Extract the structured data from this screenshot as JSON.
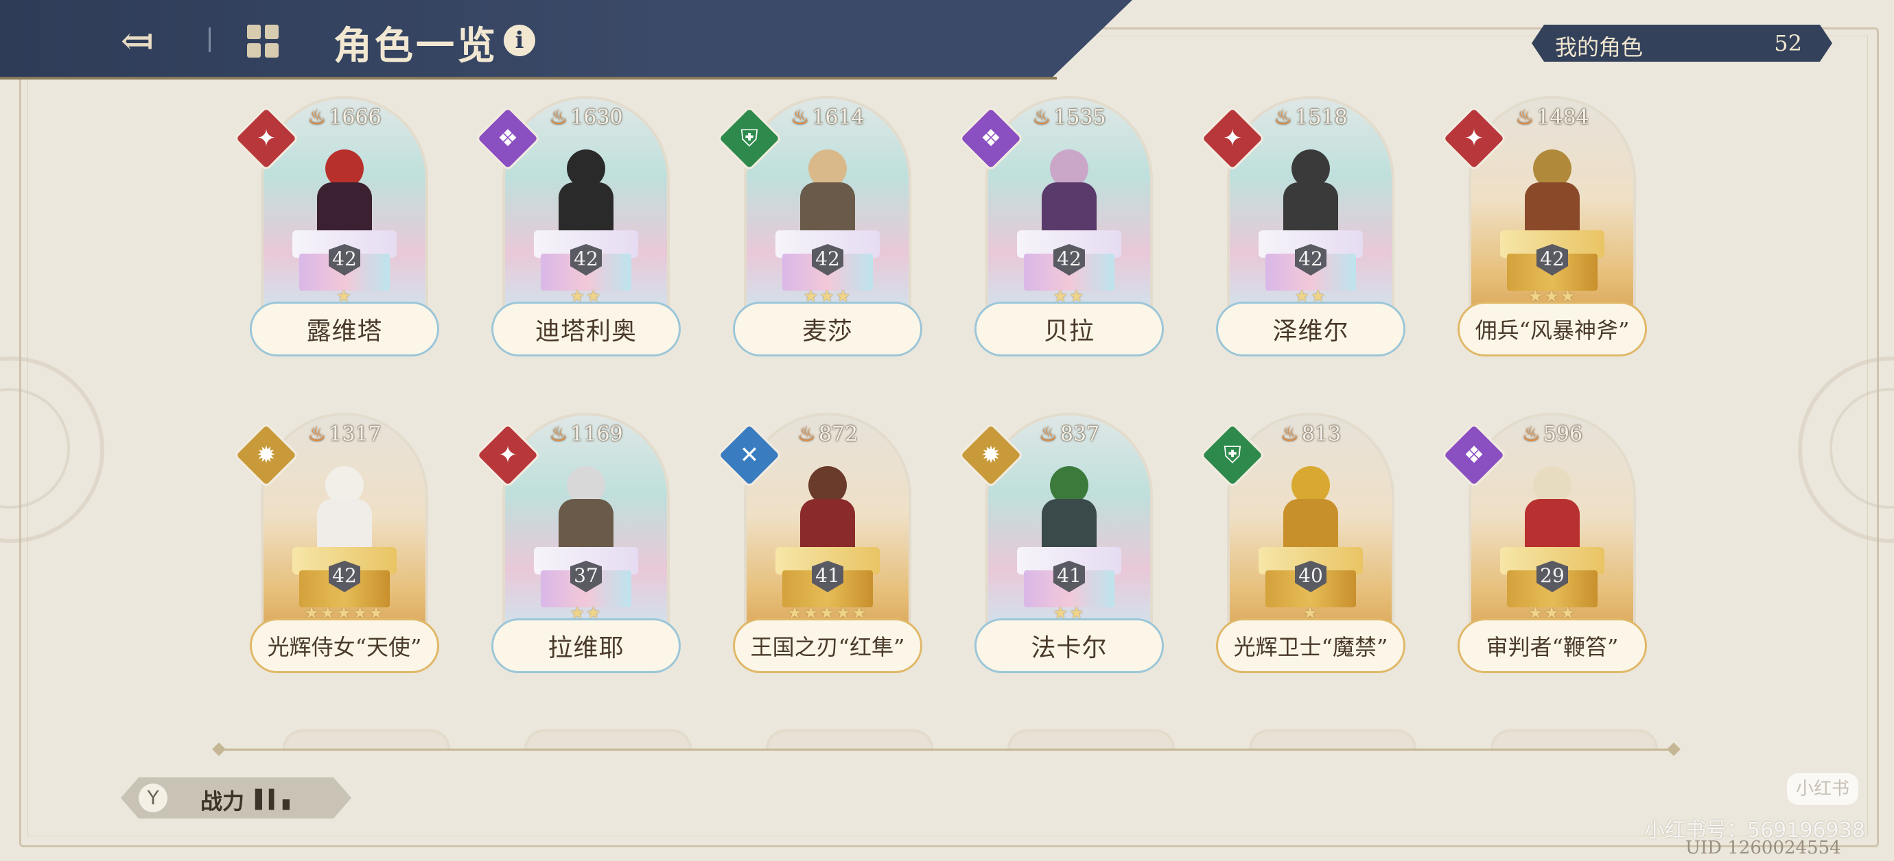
{
  "header": {
    "title": "角色一览",
    "back_icon": "back-arrow-icon",
    "grid_icon": "grid-icon",
    "info_label": "i"
  },
  "my_characters": {
    "label": "我的角色",
    "count": "52"
  },
  "element_colors": {
    "red": "#b8373b",
    "purple": "#8a4fc0",
    "green": "#2e8a4c",
    "gold": "#c89a3a",
    "blue": "#3a7cc0"
  },
  "characters": [
    {
      "name": "露维塔",
      "power": "1666",
      "level": "42",
      "stars": "★",
      "element": "red",
      "frame": "rainbow"
    },
    {
      "name": "迪塔利奥",
      "power": "1630",
      "level": "42",
      "stars": "★★",
      "element": "purple",
      "frame": "rainbow"
    },
    {
      "name": "麦莎",
      "power": "1614",
      "level": "42",
      "stars": "★★★",
      "element": "green",
      "frame": "rainbow"
    },
    {
      "name": "贝拉",
      "power": "1535",
      "level": "42",
      "stars": "★★",
      "element": "purple",
      "frame": "rainbow"
    },
    {
      "name": "泽维尔",
      "power": "1518",
      "level": "42",
      "stars": "★★",
      "element": "red",
      "frame": "rainbow"
    },
    {
      "name": "佣兵“风暴神斧”",
      "power": "1484",
      "level": "42",
      "stars": "★★★",
      "element": "red",
      "frame": "gold"
    },
    {
      "name": "光辉侍女“天使”",
      "power": "1317",
      "level": "42",
      "stars": "★★★★★",
      "element": "gold",
      "frame": "gold"
    },
    {
      "name": "拉维耶",
      "power": "1169",
      "level": "37",
      "stars": "★★",
      "element": "red",
      "frame": "rainbow"
    },
    {
      "name": "王国之刃“红隼”",
      "power": "872",
      "level": "41",
      "stars": "★★★★★",
      "element": "blue",
      "frame": "gold"
    },
    {
      "name": "法卡尔",
      "power": "837",
      "level": "41",
      "stars": "★★",
      "element": "gold",
      "frame": "rainbow"
    },
    {
      "name": "光辉卫士“魔禁”",
      "power": "813",
      "level": "40",
      "stars": "★",
      "element": "green",
      "frame": "gold"
    },
    {
      "name": "审判者“鞭笞”",
      "power": "596",
      "level": "29",
      "stars": "★★★",
      "element": "purple",
      "frame": "gold"
    }
  ],
  "filter": {
    "label": "战力",
    "filter_icon": "filter-icon",
    "sort_icon": "sort-bars-icon"
  },
  "watermark": {
    "badge": "小红书",
    "text": "小红书号：569196938"
  },
  "uid": "UID 1260024554"
}
